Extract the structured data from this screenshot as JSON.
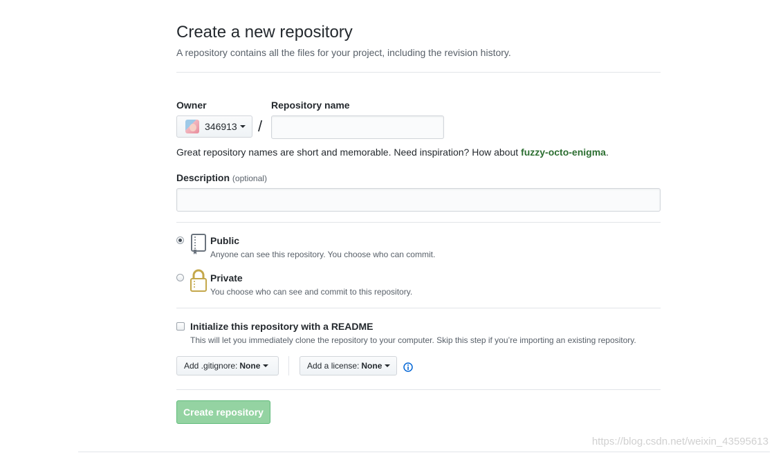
{
  "header": {
    "title": "Create a new repository",
    "subtitle": "A repository contains all the files for your project, including the revision history."
  },
  "owner": {
    "label": "Owner",
    "value": "346913",
    "avatar_icon": "avatar-image"
  },
  "separator": "/",
  "repo_name": {
    "label": "Repository name",
    "value": "",
    "placeholder": ""
  },
  "hint": {
    "text": "Great repository names are short and memorable. Need inspiration? How about ",
    "suggestion": "fuzzy-octo-enigma",
    "end": "."
  },
  "description": {
    "label": "Description",
    "optional": "(optional)",
    "value": "",
    "placeholder": ""
  },
  "visibility": {
    "selected": "public",
    "public": {
      "title": "Public",
      "desc": "Anyone can see this repository. You choose who can commit.",
      "icon": "repo-book-icon"
    },
    "private": {
      "title": "Private",
      "desc": "You choose who can see and commit to this repository.",
      "icon": "lock-icon"
    }
  },
  "readme": {
    "checked": false,
    "title": "Initialize this repository with a README",
    "desc": "This will let you immediately clone the repository to your computer. Skip this step if you’re importing an existing repository."
  },
  "gitignore": {
    "label": "Add .gitignore:",
    "value": "None"
  },
  "license": {
    "label": "Add a license:",
    "value": "None",
    "info_icon": "info-icon"
  },
  "submit": {
    "label": "Create repository"
  },
  "watermark": "https://blog.csdn.net/weixin_43595613",
  "colors": {
    "suggestion": "#2c6e31",
    "create_button_bg": "#94d3a2",
    "info_icon": "#0366d6",
    "lock_icon": "#c4a74a"
  }
}
